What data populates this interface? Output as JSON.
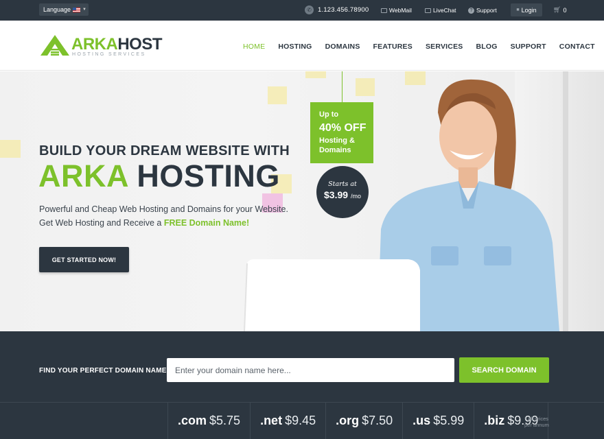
{
  "topbar": {
    "language_label": "Language",
    "phone": "1.123.456.78900",
    "webmail": "WebMail",
    "livechat": "LiveChat",
    "support": "Support",
    "login": "Login",
    "cart_count": "0"
  },
  "logo": {
    "name_part1": "ARKA",
    "name_part2": "HOST",
    "tagline": "HOSTING SERVICES"
  },
  "nav": {
    "items": [
      "HOME",
      "HOSTING",
      "DOMAINS",
      "FEATURES",
      "SERVICES",
      "BLOG",
      "SUPPORT",
      "CONTACT"
    ],
    "active": "HOME"
  },
  "hero": {
    "heading_line1": "BUILD YOUR DREAM WEBSITE WITH",
    "heading_word1": "ARKA",
    "heading_word2": "HOSTING",
    "paragraph_line1": "Powerful and Cheap Web Hosting and Domains for your Website.",
    "paragraph_line2_prefix": "Get Web Hosting and Receive a",
    "paragraph_line2_highlight": "FREE Domain Name!",
    "cta_label": "GET STARTED NOW!",
    "promo_upto": "Up to",
    "promo_off": "40% OFF",
    "promo_line1": "Hosting &",
    "promo_line2": "Domains",
    "badge_starts": "Starts at",
    "badge_price": "$3.99",
    "badge_unit": "/mo"
  },
  "domain_search": {
    "label": "FIND YOUR PERFECT DOMAIN NAME:",
    "placeholder": "Enter your domain name here...",
    "button": "SEARCH DOMAIN",
    "tlds": [
      {
        "ext": ".com",
        "price": "$5.75"
      },
      {
        "ext": ".net",
        "price": "$9.45"
      },
      {
        "ext": ".org",
        "price": "$7.50"
      },
      {
        "ext": ".us",
        "price": "$5.99"
      },
      {
        "ext": ".biz",
        "price": "$9.99"
      }
    ],
    "note_line1": "* All prices",
    "note_line2": "per annum"
  },
  "colors": {
    "accent": "#7dc12b",
    "dark": "#2c3640"
  }
}
